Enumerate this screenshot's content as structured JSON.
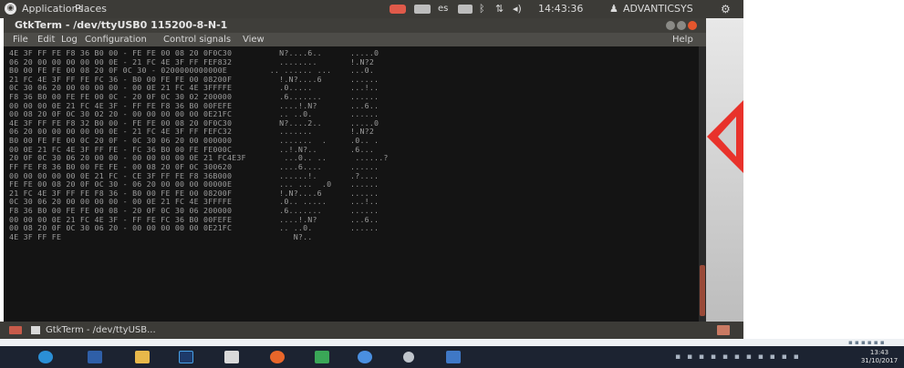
{
  "ubuntu_panel": {
    "applications_menu": "Applications",
    "places_menu": "Places",
    "keyboard_layout": "es",
    "clock": "14:43:36",
    "user": "ADVANTICSYS"
  },
  "window": {
    "title": "GtkTerm - /dev/ttyUSB0  115200-8-N-1",
    "menu": {
      "file": "File",
      "edit": "Edit",
      "log": "Log",
      "configuration": "Configuration",
      "control_signals": "Control signals",
      "view": "View",
      "help": "Help"
    }
  },
  "terminal": {
    "lines": [
      "4E 3F FF FE F8 36 B0 00 - FE FE 00 08 20 0F0C30          N?....6..      .....0",
      "06 20 00 00 00 00 00 0E - 21 FC 4E 3F FF FEF832          ........       !.N?2",
      "B0 00 FE FE 00 08 20 0F 0C 30 - 0200000000000E         .. ...... ...    ...0.",
      "21 FC 4E 3F FF FE FC 36 - B0 00 FE FE 00 08200F          !.N?....6      ......",
      "0C 30 06 20 00 00 00 00 - 00 0E 21 FC 4E 3FFFFE          .0.....        ...!..",
      "F8 36 B0 00 FE FE 00 0C - 20 0F 0C 30 02 200000          .6.......      ......",
      "00 00 00 0E 21 FC 4E 3F - FF FE F8 36 B0 00FEFE          ....!.N?       ...6..",
      "00 08 20 0F 0C 30 02 20 - 00 00 00 00 00 0E21FC          .. ..0.        ......",
      "4E 3F FF FE F8 32 B0 00 - FE FE 00 08 20 0F0C30          N?....2..      .....0",
      "06 20 00 00 00 00 00 0E - 21 FC 4E 3F FF FEFC32          .......        !.N?2",
      "B0 00 FE FE 00 0C 20 0F - 0C 30 06 20 00 000000          .......  .     .0.. .",
      "00 0E 21 FC 4E 3F FF FE - FC 36 B0 00 FE FE000C          ..!.N?..       .6...",
      "20 0F 0C 30 06 20 00 00 - 00 00 00 00 0E 21 FC4E3F        ...0.. ..      ......?",
      "FF FE F8 36 B0 00 FE FE - 00 08 20 0F 0C 300620          ....6....      ......",
      "00 00 00 00 00 0E 21 FC - CE 3F FF FE F8 36B000          ......!.       .?....",
      "FE FE 00 08 20 0F 0C 30 - 06 20 00 00 00 00000E          ... ...  .0    ......",
      "21 FC 4E 3F FF FE F8 36 - B0 00 FE FE 00 08200F          !.N?....6      ......",
      "0C 30 06 20 00 00 00 00 - 00 0E 21 FC 4E 3FFFFE          .0.. .....     ...!..",
      "F8 36 B0 00 FE FE 00 08 - 20 0F 0C 30 06 200000          .6.......      ......",
      "00 00 00 0E 21 FC 4E 3F - FF FE FC 36 B0 00FEFE          ....!.N?       ...6..",
      "00 08 20 0F 0C 30 06 20 - 00 00 00 00 00 0E21FC          .. ..0.        ......",
      "4E 3F FF FE                                                 N?.."
    ]
  },
  "bottom_panel": {
    "task_label": "GtkTerm - /dev/ttyUSB..."
  },
  "windows_taskbar": {
    "clock_time": "13:43",
    "clock_date": "31/10/2017"
  },
  "colors": {
    "ubuntu_panel": "#3c3b37",
    "terminal_bg": "#141414",
    "terminal_text": "#9c9c9c",
    "close_button": "#e5562d",
    "red_arrow": "#e8322b",
    "taskbar": "#1c2331"
  }
}
